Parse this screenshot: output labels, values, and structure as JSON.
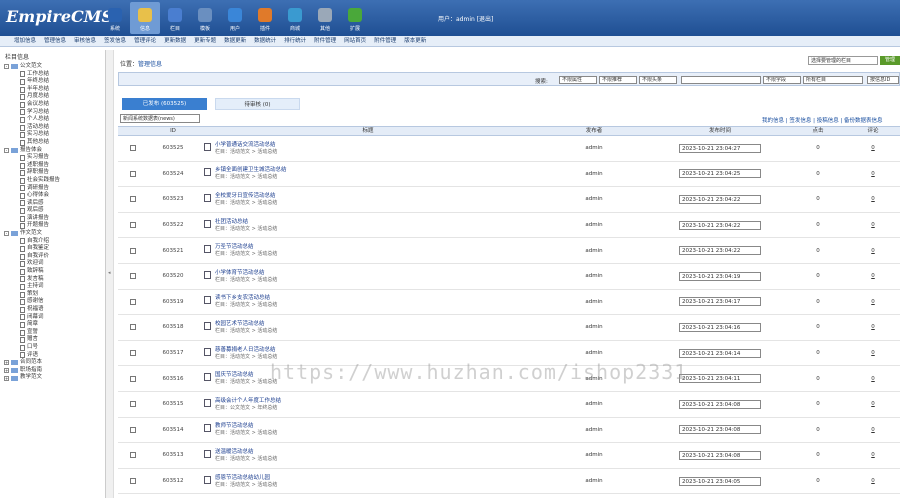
{
  "app": {
    "logo": "EmpireCMS",
    "user_text": "用户：admin [退出]"
  },
  "topnav": [
    {
      "label": "系统",
      "icon": "system-icon",
      "color": "#2a62b0"
    },
    {
      "label": "信息",
      "icon": "edit-icon",
      "color": "#e8c04a",
      "active": true
    },
    {
      "label": "栏目",
      "icon": "folder-icon",
      "color": "#4a7ed0"
    },
    {
      "label": "模板",
      "icon": "template-icon",
      "color": "#6a8fc0"
    },
    {
      "label": "用户",
      "icon": "user-icon",
      "color": "#3a86d8"
    },
    {
      "label": "插件",
      "icon": "plugin-icon",
      "color": "#e07a2a"
    },
    {
      "label": "商城",
      "icon": "shop-icon",
      "color": "#3a9ad0"
    },
    {
      "label": "其他",
      "icon": "gear-icon",
      "color": "#9aa8b8"
    },
    {
      "label": "扩展",
      "icon": "plus-icon",
      "color": "#4aa83a"
    }
  ],
  "submenu": [
    "增加信息",
    "管理信息",
    "审核信息",
    "签发信息",
    "管理评论",
    "更新数据",
    "更新专题",
    "数据更新",
    "数据统计",
    "排行统计",
    "附件管理",
    "网站首页",
    "附件管理",
    "版本更新"
  ],
  "sidebar": {
    "title": "栏目信息",
    "items": [
      {
        "label": "公文范文",
        "level": 0,
        "type": "folder",
        "exp": "-"
      },
      {
        "label": "工作总结",
        "level": 1,
        "type": "doc"
      },
      {
        "label": "年终总结",
        "level": 1,
        "type": "doc"
      },
      {
        "label": "半年总结",
        "level": 1,
        "type": "doc"
      },
      {
        "label": "月度总结",
        "level": 1,
        "type": "doc"
      },
      {
        "label": "会议总结",
        "level": 1,
        "type": "doc"
      },
      {
        "label": "学习总结",
        "level": 1,
        "type": "doc"
      },
      {
        "label": "个人总结",
        "level": 1,
        "type": "doc"
      },
      {
        "label": "活动总结",
        "level": 1,
        "type": "doc"
      },
      {
        "label": "实习总结",
        "level": 1,
        "type": "doc"
      },
      {
        "label": "其他总结",
        "level": 1,
        "type": "doc"
      },
      {
        "label": "报告体会",
        "level": 0,
        "type": "folder",
        "exp": "-"
      },
      {
        "label": "实习报告",
        "level": 1,
        "type": "doc"
      },
      {
        "label": "述职报告",
        "level": 1,
        "type": "doc"
      },
      {
        "label": "辞职报告",
        "level": 1,
        "type": "doc"
      },
      {
        "label": "社会实践报告",
        "level": 1,
        "type": "doc"
      },
      {
        "label": "调研报告",
        "level": 1,
        "type": "doc"
      },
      {
        "label": "心得体会",
        "level": 1,
        "type": "doc"
      },
      {
        "label": "读后感",
        "level": 1,
        "type": "doc"
      },
      {
        "label": "观后感",
        "level": 1,
        "type": "doc"
      },
      {
        "label": "演讲报告",
        "level": 1,
        "type": "doc"
      },
      {
        "label": "开题报告",
        "level": 1,
        "type": "doc"
      },
      {
        "label": "作文范文",
        "level": 0,
        "type": "folder",
        "exp": "-"
      },
      {
        "label": "自我介绍",
        "level": 1,
        "type": "doc"
      },
      {
        "label": "自我鉴定",
        "level": 1,
        "type": "doc"
      },
      {
        "label": "自我评价",
        "level": 1,
        "type": "doc"
      },
      {
        "label": "欢迎词",
        "level": 1,
        "type": "doc"
      },
      {
        "label": "致辞稿",
        "level": 1,
        "type": "doc"
      },
      {
        "label": "发言稿",
        "level": 1,
        "type": "doc"
      },
      {
        "label": "主持词",
        "level": 1,
        "type": "doc"
      },
      {
        "label": "策划",
        "level": 1,
        "type": "doc"
      },
      {
        "label": "感谢信",
        "level": 1,
        "type": "doc"
      },
      {
        "label": "祝福语",
        "level": 1,
        "type": "doc"
      },
      {
        "label": "闭幕词",
        "level": 1,
        "type": "doc"
      },
      {
        "label": "简章",
        "level": 1,
        "type": "doc"
      },
      {
        "label": "宣誓",
        "level": 1,
        "type": "doc"
      },
      {
        "label": "赠言",
        "level": 1,
        "type": "doc"
      },
      {
        "label": "口号",
        "level": 1,
        "type": "doc"
      },
      {
        "label": "评语",
        "level": 1,
        "type": "doc"
      },
      {
        "label": "合同范本",
        "level": 0,
        "type": "folder",
        "exp": "+"
      },
      {
        "label": "职场指南",
        "level": 0,
        "type": "folder",
        "exp": "+"
      },
      {
        "label": "教学范文",
        "level": 0,
        "type": "folder",
        "exp": "+"
      }
    ]
  },
  "main": {
    "location_label": "位置：",
    "location_link": "管理信息",
    "location_select": "选择要管理的栏目",
    "location_btn": "管理",
    "search": {
      "label": "搜索:",
      "f1": "不限属性",
      "f2": "不限推荐",
      "f3": "不限头条",
      "f4": "",
      "f5": "不限字段",
      "f6": "所有栏目",
      "f7": "按信息ID"
    },
    "tabs": [
      {
        "label": "已发布 (603525)",
        "active": true
      },
      {
        "label": "待审核 (0)",
        "active": false
      }
    ],
    "filter_select": "新闻系统数据表(news)",
    "right_links": "我的信息 | 签发信息 | 投稿信息 | 备份数据表信息",
    "columns": [
      "ID",
      "标题",
      "发布者",
      "发布时间",
      "点击",
      "评论"
    ],
    "rows": [
      {
        "id": "603525",
        "title": "小学普通话交流活动总结",
        "cat": "栏目：活动范文 > 活动总结",
        "pub": "admin",
        "time": "2023-10-21 23:04:27",
        "clicks": "0",
        "comments": "0"
      },
      {
        "id": "603524",
        "title": "乡镇全面创建卫生城活动总结",
        "cat": "栏目：活动范文 > 活动总结",
        "pub": "admin",
        "time": "2023-10-21 23:04:25",
        "clicks": "0",
        "comments": "0"
      },
      {
        "id": "603523",
        "title": "全校爱牙日宣传活动总结",
        "cat": "栏目：活动范文 > 活动总结",
        "pub": "admin",
        "time": "2023-10-21 23:04:22",
        "clicks": "0",
        "comments": "0"
      },
      {
        "id": "603522",
        "title": "社团活动总结",
        "cat": "栏目：活动范文 > 活动总结",
        "pub": "admin",
        "time": "2023-10-21 23:04:22",
        "clicks": "0",
        "comments": "0"
      },
      {
        "id": "603521",
        "title": "万圣节活动总结",
        "cat": "栏目：活动范文 > 活动总结",
        "pub": "admin",
        "time": "2023-10-21 23:04:22",
        "clicks": "0",
        "comments": "0"
      },
      {
        "id": "603520",
        "title": "小学体育节活动总结",
        "cat": "栏目：活动范文 > 活动总结",
        "pub": "admin",
        "time": "2023-10-21 23:04:19",
        "clicks": "0",
        "comments": "0"
      },
      {
        "id": "603519",
        "title": "读书下乡支农活动总结",
        "cat": "栏目：活动范文 > 活动总结",
        "pub": "admin",
        "time": "2023-10-21 23:04:17",
        "clicks": "0",
        "comments": "0"
      },
      {
        "id": "603518",
        "title": "校园艺术节活动总结",
        "cat": "栏目：活动范文 > 活动总结",
        "pub": "admin",
        "time": "2023-10-21 23:04:16",
        "clicks": "0",
        "comments": "0"
      },
      {
        "id": "603517",
        "title": "慈善募捐老人日活动总结",
        "cat": "栏目：活动范文 > 活动总结",
        "pub": "admin",
        "time": "2023-10-21 23:04:14",
        "clicks": "0",
        "comments": "0"
      },
      {
        "id": "603516",
        "title": "国庆节活动总结",
        "cat": "栏目：活动范文 > 活动总结",
        "pub": "admin",
        "time": "2023-10-21 23:04:11",
        "clicks": "0",
        "comments": "0"
      },
      {
        "id": "603515",
        "title": "高级会计个人年度工作总结",
        "cat": "栏目：公文范文 > 年终总结",
        "pub": "admin",
        "time": "2023-10-21 23:04:08",
        "clicks": "0",
        "comments": "0"
      },
      {
        "id": "603514",
        "title": "教师节活动总结",
        "cat": "栏目：活动范文 > 活动总结",
        "pub": "admin",
        "time": "2023-10-21 23:04:08",
        "clicks": "0",
        "comments": "0"
      },
      {
        "id": "603513",
        "title": "送温暖活动总结",
        "cat": "栏目：活动范文 > 活动总结",
        "pub": "admin",
        "time": "2023-10-21 23:04:08",
        "clicks": "0",
        "comments": "0"
      },
      {
        "id": "603512",
        "title": "感恩节活动总结幼儿园",
        "cat": "栏目：活动范文 > 活动总结",
        "pub": "admin",
        "time": "2023-10-21 23:04:05",
        "clicks": "0",
        "comments": "0"
      }
    ]
  },
  "watermark": "https://www.huzhan.com/ishop2331"
}
